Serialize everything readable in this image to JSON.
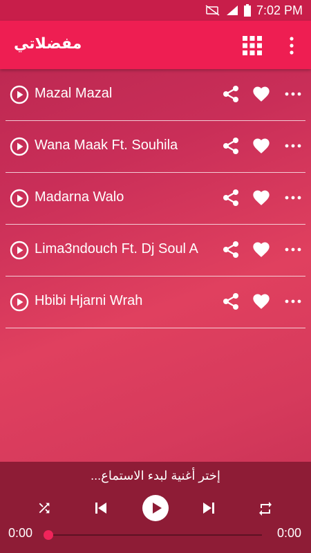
{
  "status": {
    "time": "7:02 PM"
  },
  "appbar": {
    "title": "مفضلاتي"
  },
  "songs": [
    {
      "title": "Mazal Mazal"
    },
    {
      "title": "Wana Maak Ft. Souhila"
    },
    {
      "title": "Madarna Walo"
    },
    {
      "title": "Lima3ndouch Ft. Dj Soul A"
    },
    {
      "title": "Hbibi Hjarni Wrah"
    }
  ],
  "player": {
    "hint": "إختر أغنية لبدء الاستماع...",
    "time_elapsed": "0:00",
    "time_total": "0:00",
    "progress": 0
  },
  "colors": {
    "appbar": "#ee1e52",
    "statusbar": "#c81e4a",
    "player": "#8e1c36",
    "accent": "#f0245a"
  },
  "icons": [
    "no-sim-icon",
    "signal-icon",
    "battery-icon",
    "grid-icon",
    "more-vert-icon",
    "play-circle-icon",
    "share-icon",
    "heart-icon",
    "more-horiz-icon",
    "shuffle-icon",
    "skip-previous-icon",
    "play-icon",
    "skip-next-icon",
    "repeat-icon"
  ]
}
